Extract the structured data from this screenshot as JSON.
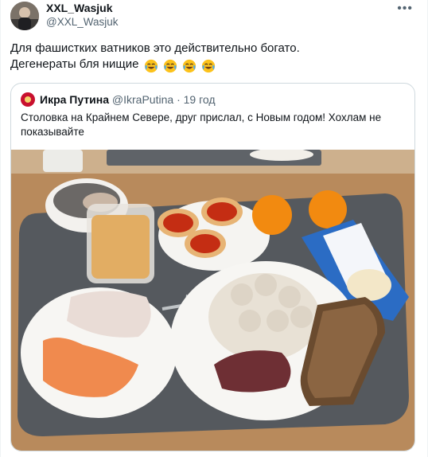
{
  "author": {
    "display_name": "XXL_Wasjuk",
    "handle": "@XXL_Wasjuk",
    "avatar_icon": "profile-photo-avatar"
  },
  "menu": {
    "icon": "more-horizontal-icon",
    "glyph": "•••"
  },
  "tweet": {
    "line1": "Для фашистких ватников это действительно богато.",
    "line2": "Дегенераты бля нищие",
    "emojis": [
      "laughing-crying-emoji",
      "laughing-crying-emoji",
      "laughing-crying-emoji",
      "laughing-crying-emoji"
    ]
  },
  "quoted_tweet": {
    "display_name": "Икра Путина",
    "handle": "@IkraPutina",
    "separator": "·",
    "time": "19 год",
    "text": "Столовка на Крайнем Севере, друг прислал, с Новым годом! Хохлам не показывайте",
    "photo_icon": "canteen-food-tray-photo"
  },
  "colors": {
    "text_primary": "#0f1419",
    "text_secondary": "#536471",
    "border": "#cfd9de",
    "quote_avatar": "#c8102e"
  }
}
